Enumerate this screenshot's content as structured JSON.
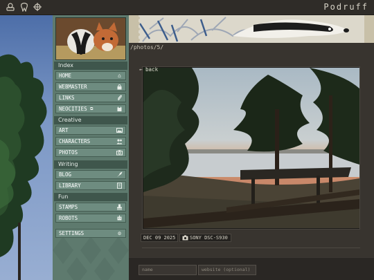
{
  "topbar": {
    "brand": "Podruff",
    "icons": [
      "shapes-icon",
      "tooth-icon",
      "crosshair-icon"
    ]
  },
  "sidebar": {
    "sections": [
      {
        "title": "Index",
        "items": [
          {
            "label": "HOME",
            "icon": "home-icon"
          },
          {
            "label": "WEBMASTER",
            "icon": "lock-icon"
          },
          {
            "label": "LINKS",
            "icon": "paperclip-icon"
          },
          {
            "label": "NEOCITIES",
            "external": "⧉",
            "icon": "cat-icon"
          }
        ]
      },
      {
        "title": "Creative",
        "items": [
          {
            "label": "ART",
            "icon": "image-icon"
          },
          {
            "label": "CHARACTERS",
            "icon": "people-icon"
          },
          {
            "label": "PHOTOS",
            "icon": "camera-icon"
          }
        ]
      },
      {
        "title": "Writing",
        "items": [
          {
            "label": "BLOG",
            "icon": "quill-icon"
          },
          {
            "label": "LIBRARY",
            "icon": "book-icon"
          }
        ]
      },
      {
        "title": "Fun",
        "items": [
          {
            "label": "STAMPS",
            "icon": "stamp-icon"
          },
          {
            "label": "ROBOTS",
            "icon": "robot-icon"
          }
        ]
      }
    ],
    "settings": {
      "label": "SETTINGS",
      "icon": "gear-icon"
    }
  },
  "main": {
    "path": "/photos/5/",
    "back_label": "← back",
    "photo_meta": {
      "date": "DEC 09 2025",
      "camera": "SONY DSC-S930"
    },
    "comment_form": {
      "name_placeholder": "name",
      "website_placeholder": "website (optional)"
    }
  },
  "colors": {
    "sidebar": "#5e7a6e",
    "nav_button": "#6e8c80",
    "section_header": "#3f564c",
    "main_bg": "#38342f",
    "topbar": "#2f2c28"
  }
}
